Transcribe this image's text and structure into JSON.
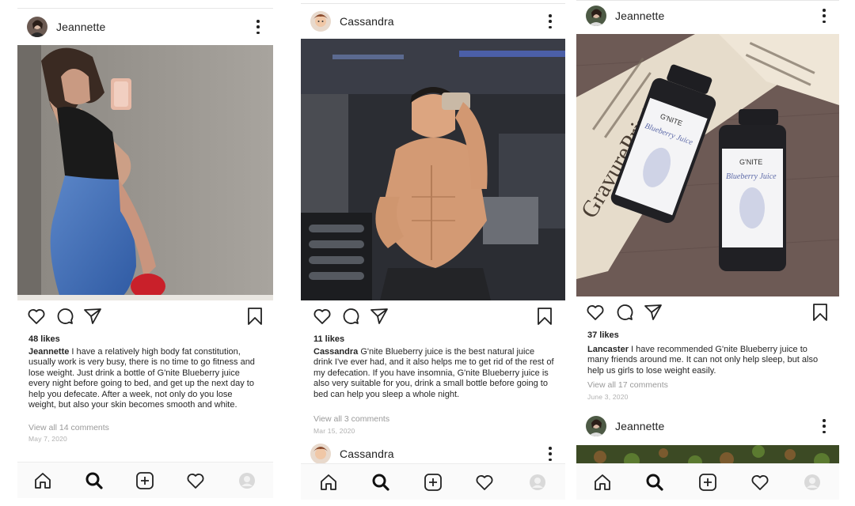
{
  "colors": {
    "text": "#262626",
    "muted": "#9a9a9a",
    "date": "#b0b0b0",
    "tabbar": "#fafafa"
  },
  "tabbar_icons": [
    "home-icon",
    "search-icon",
    "add-icon",
    "heart-icon",
    "profile-icon"
  ],
  "action_icons": [
    "heart-icon",
    "comment-icon",
    "share-icon",
    "bookmark-icon"
  ],
  "screens": [
    {
      "post": {
        "username": "Jeannette",
        "likes": "48 likes",
        "caption_user": "Jeannette",
        "caption_text": " I have a relatively high body fat constitution, usually work is very busy, there is no time to go fitness and lose weight. Just drink a bottle of G'nite Blueberry juice every night before going to bed, and get up the next day to help you defecate. After a week, not only do you lose weight, but also your skin becomes smooth and white.",
        "view_comments": "View all 14 comments",
        "date": "May 7, 2020"
      }
    },
    {
      "post": {
        "username": "Cassandra",
        "likes": "11 likes",
        "caption_user": "Cassandra",
        "caption_text": " G'nite Blueberry juice is the best natural juice drink I've ever had, and it also helps me to get rid of the rest of my defecation. If you have insomnia, G'nite Blueberry juice is also very suitable for you, drink a small bottle before going to bed can help you sleep a whole night.",
        "view_comments": "View all 3 comments",
        "date": "Mar 15, 2020"
      },
      "next_post": {
        "username": "Cassandra"
      }
    },
    {
      "post": {
        "username": "Jeannette",
        "likes": "37 likes",
        "caption_user": "Lancaster",
        "caption_text": " I have recommended G'nite Blueberry juice to many friends around me. It can not only help sleep, but also help us girls to lose weight easily.",
        "view_comments": "View all 17 comments",
        "date": "June 3, 2020"
      },
      "next_post": {
        "username": "Jeannette"
      },
      "bottle_label": {
        "brand": "G'NITE",
        "flavor": "Blueberry Juice"
      },
      "newspaper_text": "GravurePrint"
    }
  ]
}
